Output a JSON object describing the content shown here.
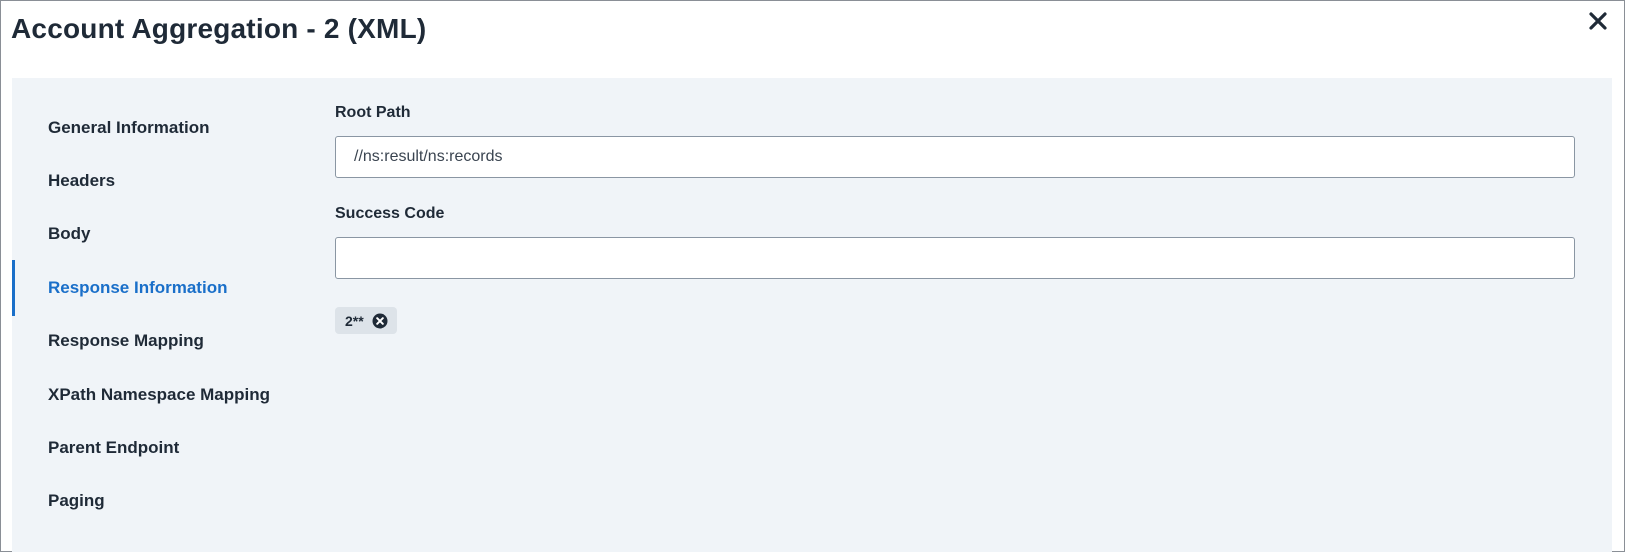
{
  "dialog": {
    "title": "Account Aggregation - 2 (XML)",
    "close_icon": "close-icon"
  },
  "sidebar": {
    "items": [
      {
        "label": "General Information",
        "active": false
      },
      {
        "label": "Headers",
        "active": false
      },
      {
        "label": "Body",
        "active": false
      },
      {
        "label": "Response Information",
        "active": true
      },
      {
        "label": "Response Mapping",
        "active": false
      },
      {
        "label": "XPath Namespace Mapping",
        "active": false
      },
      {
        "label": "Parent Endpoint",
        "active": false
      },
      {
        "label": "Paging",
        "active": false
      }
    ]
  },
  "form": {
    "root_path": {
      "label": "Root Path",
      "value": "//ns:result/ns:records"
    },
    "success_code": {
      "label": "Success Code",
      "value": "",
      "chips": [
        {
          "label": "2**",
          "remove_icon": "remove-circle-icon"
        }
      ]
    }
  },
  "colors": {
    "accent": "#1a6fc9",
    "panel_bg": "#f0f4f8",
    "chip_bg": "#dde3e9"
  }
}
